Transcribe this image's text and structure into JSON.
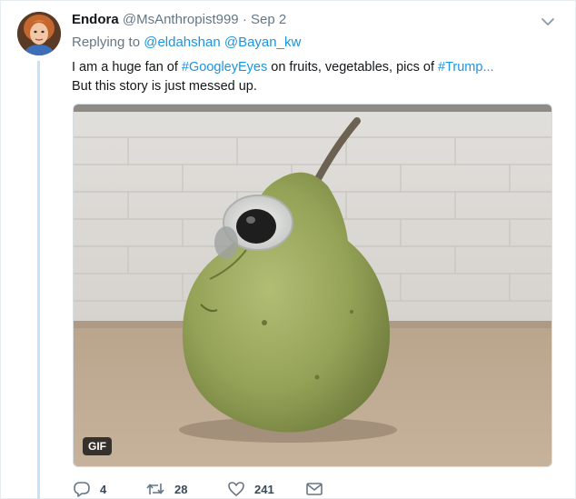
{
  "author": {
    "name": "Endora",
    "handle": "@MsAnthropist999",
    "separator": "·",
    "time": "Sep 2"
  },
  "reply": {
    "prefix": "Replying to",
    "users": [
      "@eldahshan",
      "@Bayan_kw"
    ]
  },
  "tweet": {
    "line1_a": "I am a huge fan of ",
    "hashtag1": "#GoogleyEyes",
    "line1_b": " on fruits, vegetables, pics of ",
    "hashtag2": "#Trump",
    "line1_c": "...",
    "line2": "But this story is just messed up."
  },
  "media": {
    "badge": "GIF"
  },
  "actions": {
    "replies": "4",
    "retweets": "28",
    "likes": "241"
  },
  "colors": {
    "link": "#1b95e0",
    "secondary_text": "#657786",
    "thread_line": "#c4e3f6"
  },
  "icons": [
    "caret-down-icon",
    "reply-icon",
    "retweet-icon",
    "like-icon",
    "direct-message-icon"
  ]
}
